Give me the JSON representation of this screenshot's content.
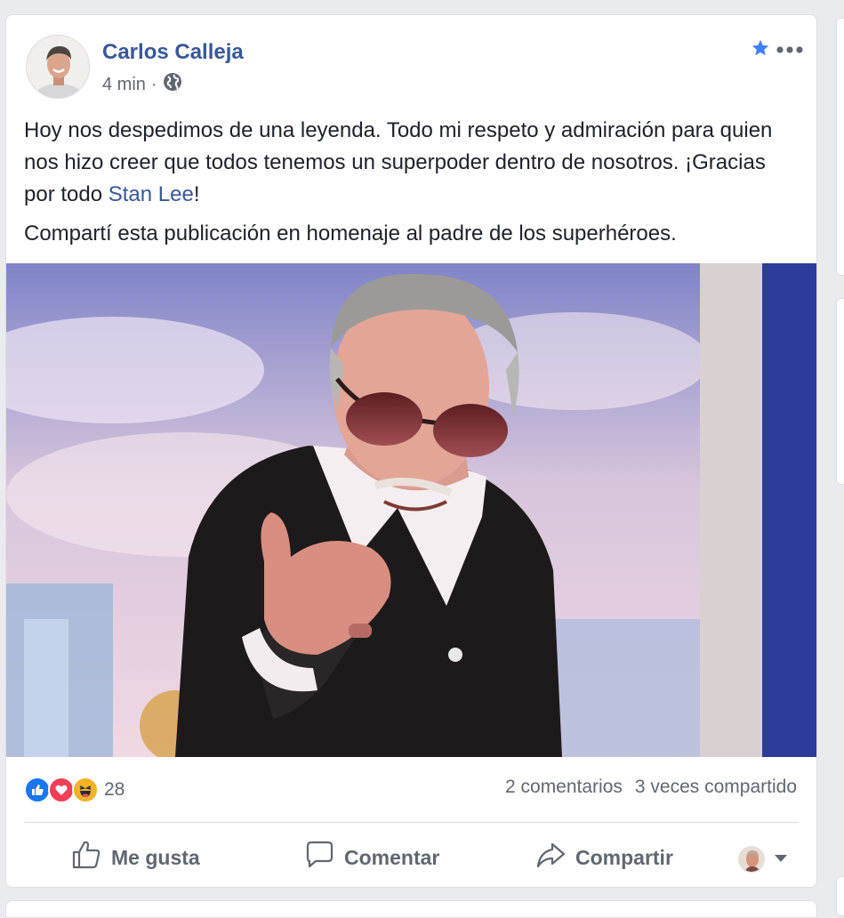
{
  "post": {
    "author": "Carlos Calleja",
    "time": "4 min",
    "separator": "·",
    "privacy_icon": "globe-icon",
    "text_p1_before": "Hoy nos despedimos de una leyenda. Todo mi respeto y admiración para quien nos hizo creer que todos tenemos un superpoder dentro de nosotros. ¡Gracias por todo ",
    "mention": "Stan Lee",
    "text_p1_after": "!",
    "text_p2": "Compartí esta publicación en homenaje al padre de los superhéroes.",
    "photo_subject": "elderly man with sunglasses pointing at camera"
  },
  "reactions": {
    "icons": [
      "like-icon",
      "love-icon",
      "haha-icon"
    ],
    "count": "28"
  },
  "stats": {
    "comments": "2 comentarios",
    "shares": "3 veces compartido"
  },
  "actions": {
    "like": "Me gusta",
    "comment": "Comentar",
    "share": "Compartir"
  },
  "colors": {
    "link": "#385898",
    "like_blue": "#1877f2",
    "love_red": "#f33e58",
    "haha_yellow": "#f7b125",
    "star_blue": "#4080ff",
    "muted": "#606770"
  }
}
